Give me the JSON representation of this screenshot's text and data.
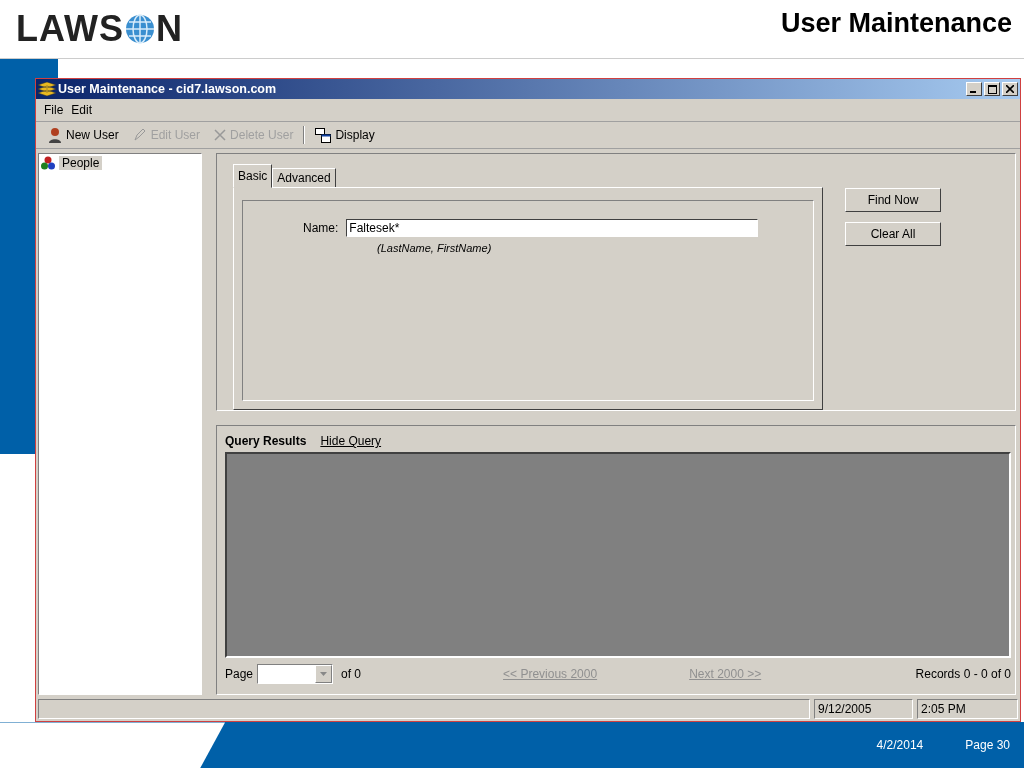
{
  "slide": {
    "logo": {
      "before": "LAWS",
      "after": "N"
    },
    "title": "User Maintenance",
    "date": "4/2/2014",
    "page": "Page 30"
  },
  "window": {
    "title": "User Maintenance - cid7.lawson.com"
  },
  "menu": [
    "File",
    "Edit"
  ],
  "toolbar": [
    {
      "label": "New User",
      "kind": "new",
      "disabled": false
    },
    {
      "label": "Edit User",
      "kind": "edit",
      "disabled": true
    },
    {
      "label": "Delete User",
      "kind": "delete",
      "disabled": true
    },
    {
      "label": "Display",
      "kind": "display",
      "disabled": false
    }
  ],
  "tree": [
    {
      "label": "People",
      "selected": true
    }
  ],
  "tabs": [
    {
      "label": "Basic",
      "selected": true
    },
    {
      "label": "Advanced",
      "selected": false
    }
  ],
  "name_field": {
    "label": "Name:",
    "value": "Faltesek*",
    "hint": "(LastName, FirstName)"
  },
  "buttons": [
    "Find Now",
    "Clear All"
  ],
  "results": {
    "title": "Query Results",
    "link": "Hide Query",
    "page_label": "Page",
    "of": "of 0",
    "prev": {
      "label": "<< Previous 2000",
      "disabled": true
    },
    "next": {
      "label": "Next 2000 >>",
      "disabled": true
    },
    "records": "Records 0 - 0 of 0"
  },
  "status_bar": {
    "date": "9/12/2005",
    "time": "2:05 PM"
  }
}
